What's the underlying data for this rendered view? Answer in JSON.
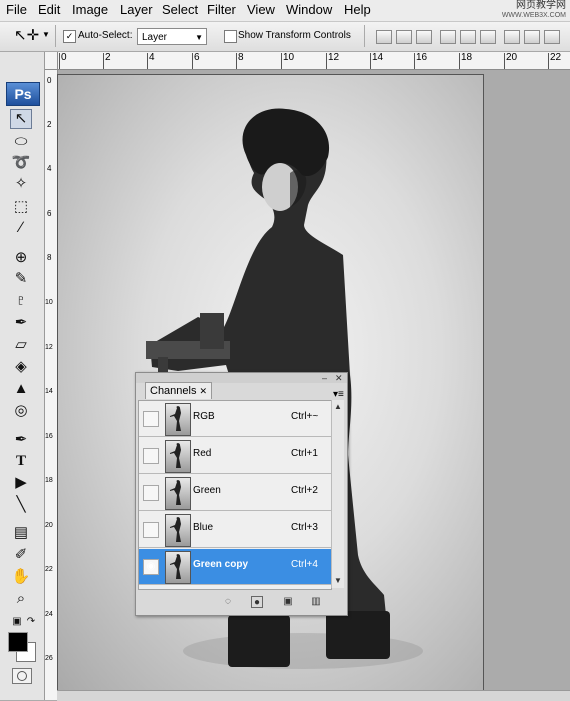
{
  "menubar": {
    "items": [
      "File",
      "Edit",
      "Image",
      "Layer",
      "Select",
      "Filter",
      "View",
      "Window",
      "Help"
    ],
    "watermark": {
      "line1": "网页教学网",
      "line2": "WWW.WEB3X.COM"
    }
  },
  "options_bar": {
    "auto_select_label": "Auto-Select:",
    "auto_select_value": "Layer",
    "show_transform_label": "Show Transform Controls"
  },
  "ruler": {
    "top_labels": [
      "0",
      "2",
      "4",
      "6",
      "8",
      "10",
      "12",
      "14",
      "16",
      "18",
      "20",
      "22"
    ],
    "left_labels": [
      "0",
      "2",
      "4",
      "6",
      "8",
      "10",
      "12",
      "14",
      "16",
      "18",
      "20",
      "22",
      "24",
      "26"
    ]
  },
  "toolbox": {
    "logo_text": "Ps"
  },
  "channels_panel": {
    "tab_label": "Channels",
    "channels": [
      {
        "name": "RGB",
        "shortcut": "Ctrl+~",
        "visible": false,
        "selected": false
      },
      {
        "name": "Red",
        "shortcut": "Ctrl+1",
        "visible": false,
        "selected": false
      },
      {
        "name": "Green",
        "shortcut": "Ctrl+2",
        "visible": false,
        "selected": false
      },
      {
        "name": "Blue",
        "shortcut": "Ctrl+3",
        "visible": false,
        "selected": false
      },
      {
        "name": "Green copy",
        "shortcut": "Ctrl+4",
        "visible": true,
        "selected": true
      }
    ]
  },
  "colors": {
    "selection": "#3b8ee3",
    "ps_logo": "#2f6bc2"
  }
}
